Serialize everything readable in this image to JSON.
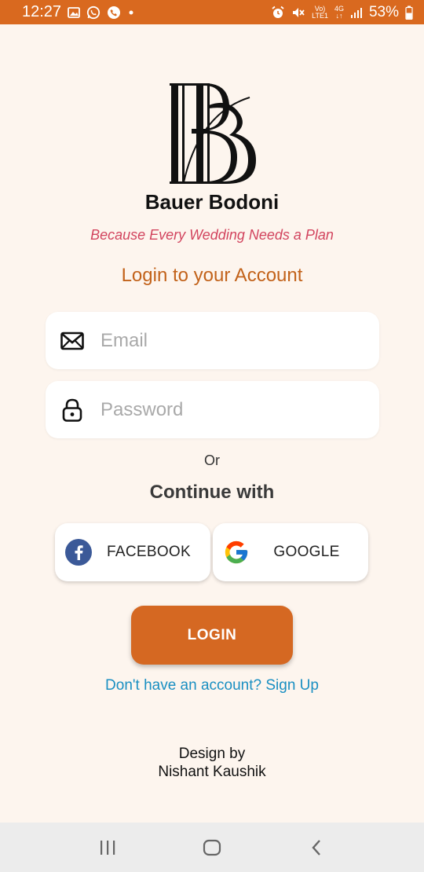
{
  "status_bar": {
    "time": "12:27",
    "network_label_top": "Vo)",
    "network_label_bottom": "LTE1",
    "network_4g": "4G",
    "battery": "53%",
    "icons": [
      "gallery-icon",
      "whatsapp-icon",
      "call-icon",
      "dot-icon",
      "alarm-icon",
      "mute-icon",
      "signal-icon",
      "battery-icon"
    ]
  },
  "brand": {
    "name": "Bauer Bodoni",
    "tagline": "Because Every Wedding Needs a Plan"
  },
  "login": {
    "heading": "Login to your Account",
    "email_placeholder": "Email",
    "email_value": "",
    "password_placeholder": "Password",
    "password_value": "",
    "or": "Or",
    "continue_with": "Continue with",
    "facebook_label": "FACEBOOK",
    "google_label": "GOOGLE",
    "login_label": "LOGIN",
    "signup_text": "Don't have an account? Sign Up"
  },
  "credit": {
    "line1": "Design by",
    "line2": "Nishant Kaushik"
  },
  "nav": {
    "buttons": [
      "recent-apps-icon",
      "home-icon",
      "back-icon"
    ]
  },
  "colors": {
    "accent": "#d56822",
    "status_bar": "#d9691f",
    "background": "#fdf5ee",
    "tagline": "#d2445e",
    "heading": "#c2621a",
    "link": "#1a8fc2"
  }
}
